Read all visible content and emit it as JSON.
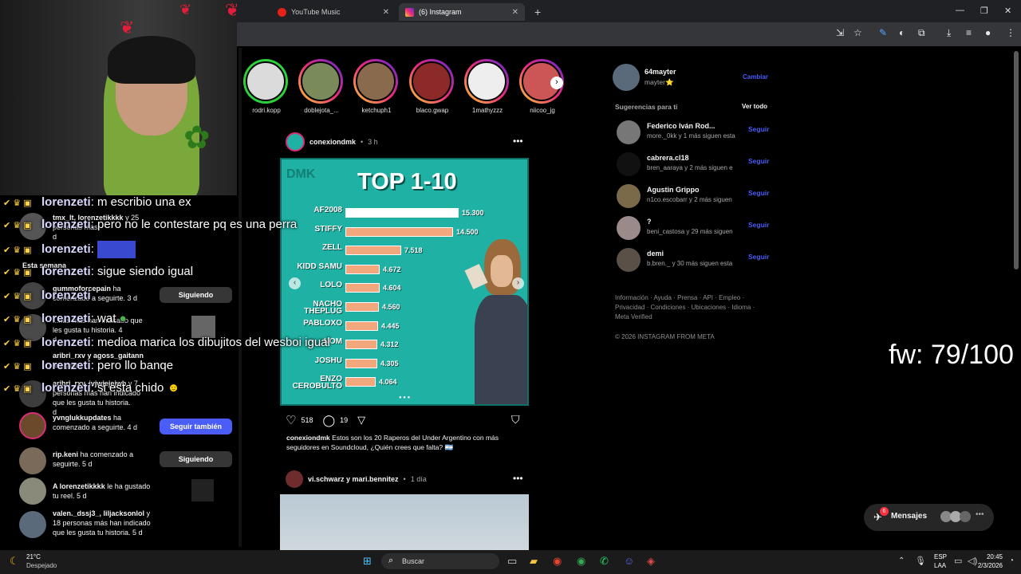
{
  "browser": {
    "tabs": [
      {
        "label": "YouTube Music"
      },
      {
        "label": "(6) Instagram"
      }
    ]
  },
  "stories": [
    {
      "name": "rodri.kopp",
      "ring": "grey"
    },
    {
      "name": "doblejota_...",
      "ring": "gradient"
    },
    {
      "name": "ketchuph1",
      "ring": "gradient"
    },
    {
      "name": "blaco.gwap",
      "ring": "gradient"
    },
    {
      "name": "1mathyzzz",
      "ring": "gradient"
    },
    {
      "name": "niicoo_jg",
      "ring": "gradient"
    }
  ],
  "post1": {
    "author": "conexiondmk",
    "time": "3 h",
    "image": {
      "logo": "DMK",
      "title": "TOP 1-10",
      "rows": [
        {
          "label": "AF2008",
          "value": "15.300",
          "amount": 15300
        },
        {
          "label": "STIFFY",
          "value": "14.500",
          "amount": 14500
        },
        {
          "label": "ZELL",
          "value": "7.518",
          "amount": 7518
        },
        {
          "label": "KIDD SAMU",
          "value": "4.672",
          "amount": 4672
        },
        {
          "label": "LOLO",
          "value": "4.604",
          "amount": 4604
        },
        {
          "label": "NACHO THEPLUG",
          "value": "4.560",
          "amount": 4560
        },
        {
          "label": "PABLOXO",
          "value": "4.445",
          "amount": 4445
        },
        {
          "label": "NOM",
          "value": "4.312",
          "amount": 4312
        },
        {
          "label": "JOSHU",
          "value": "4.305",
          "amount": 4305
        },
        {
          "label": "ENZO CEROBULTO",
          "value": "4.064",
          "amount": 4064
        }
      ]
    },
    "likes": "518",
    "comments": "19",
    "caption_user": "conexiondmk",
    "caption": "Estos son los 20 Raperos del Under Argentino con más seguidores en Soundcloud, ¿Quién crees que falta? 🇦🇷"
  },
  "post2": {
    "authors": "vi.schwarz y mari.bennitez",
    "time": "1 día"
  },
  "profile": {
    "username": "64mayter",
    "name": "mayter⭐",
    "switch_label": "Cambiar"
  },
  "suggestions": {
    "title": "Sugerencias para ti",
    "see_all": "Ver todo",
    "follow_label": "Seguir",
    "items": [
      {
        "name": "Federico Iván Rod...",
        "sub": "more._0kk y 1 más siguen esta"
      },
      {
        "name": "cabrera.cl18",
        "sub": "bren_aaraya y 2 más siguen e"
      },
      {
        "name": "Agustin Grippo",
        "sub": "n1co.escobarr y 2 más siguen"
      },
      {
        "name": "?",
        "sub": "beni_castosa y 29 más siguen"
      },
      {
        "name": "demi",
        "sub": "b.bren._ y 30 más siguen esta"
      }
    ]
  },
  "footer": {
    "links1": "Información · Ayuda · Prensa · API · Empleo ·",
    "links2": "Privacidad · Condiciones · Ubicaciones · Idioma ·",
    "links3": "Meta Verified",
    "copyright": "© 2026 INSTAGRAM FROM META"
  },
  "notifications": {
    "section_label": "Esta semana",
    "items": [
      {
        "user": "tmx_lt, lorenzetikkkk",
        "text": "y 25 personas más",
        "tail": "d"
      },
      {
        "user": "gummoforcepain",
        "text": "ha comenzado a seguirte. 3 d",
        "button": "Siguiendo"
      },
      {
        "user": "",
        "text": "...nas más han indicado que les gusta tu historia. 4",
        "tail": "d"
      },
      {
        "user": "aribri_rxv y agoss_gaitann",
        "text": "les gusta"
      },
      {
        "user": "aribri_rxv, ivjwjejejwb",
        "text": "y 7 personas más han indicado que les gusta tu historia.",
        "tail": "d"
      },
      {
        "user": "yvnglukkupdates",
        "text": "ha comenzado a seguirte. 4 d",
        "button": "Seguir también"
      },
      {
        "user": "rip.keni",
        "text": "ha comenzado a seguirte. 5 d",
        "button": "Siguiendo"
      },
      {
        "user": "A lorenzetikkkk",
        "text": "le ha gustado tu reel. 5 d"
      },
      {
        "user": "valen._dssj3_, liljacksonlol",
        "text": "y 18 personas más han indicado que les gusta tu historia. 5 d"
      }
    ]
  },
  "chat": [
    {
      "user": "lorenzeti",
      "msg": ": m escribio una ex"
    },
    {
      "user": "lorenzeti",
      "msg": ": pero no le contestare pq es una perra"
    },
    {
      "user": "lorenzeti",
      "msg": ":"
    },
    {
      "user": "lorenzeti",
      "msg": ": sigue siendo igual"
    },
    {
      "user": "lorenzeti",
      "msg": ""
    },
    {
      "user": "lorenzeti",
      "msg": ": wat"
    },
    {
      "user": "lorenzeti",
      "msg": ": medioa marica los dibujitos del wesboi igual"
    },
    {
      "user": "lorenzeti",
      "msg": ": pero llo banqe"
    },
    {
      "user": "lorenzeti",
      "msg": ": si esta chido"
    }
  ],
  "messages": {
    "label": "Mensajes",
    "badge": "6"
  },
  "overlay_fw": "fw: 79/100",
  "taskbar": {
    "weather_temp": "21°C",
    "weather_desc": "Despejado",
    "search": "Buscar",
    "lang1": "ESP",
    "lang2": "LAA",
    "time": "20:45",
    "date": "2/3/2026"
  },
  "colors": {
    "accent": "#4a5df9",
    "post_bg": "#1fb1a4",
    "bar": "#f3a77c"
  }
}
